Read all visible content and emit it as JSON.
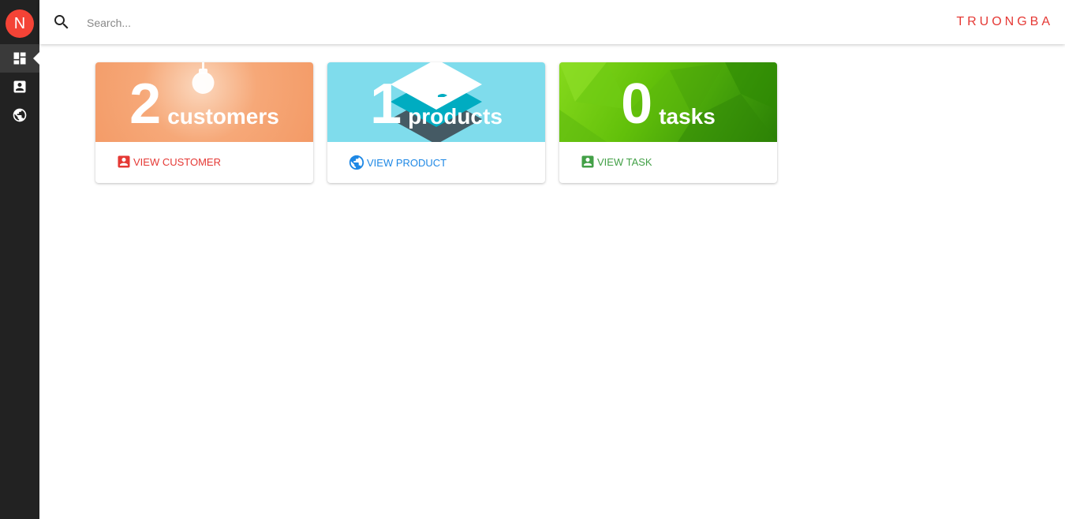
{
  "user": {
    "initial": "N"
  },
  "search": {
    "placeholder": "Search..."
  },
  "brand": {
    "logo_text": "TRUONGBA"
  },
  "sidebar": {
    "items": [
      {
        "icon": "dashboard-icon",
        "active": true
      },
      {
        "icon": "contact-card-icon",
        "active": false
      },
      {
        "icon": "globe-icon",
        "active": false
      }
    ]
  },
  "cards": [
    {
      "count": "2",
      "unit": "customers",
      "action": "VIEW CUSTOMER",
      "action_icon": "contact-card-icon",
      "action_color": "#e53935"
    },
    {
      "count": "1",
      "unit": "products",
      "action": "VIEW PRODUCT",
      "action_icon": "globe-icon",
      "action_color": "#1e88e5"
    },
    {
      "count": "0",
      "unit": "tasks",
      "action": "VIEW TASK",
      "action_icon": "contact-card-icon",
      "action_color": "#43a047"
    }
  ],
  "colors": {
    "sidebar_bg": "#222222",
    "avatar_bg": "#f44336",
    "brand": "#e53935"
  }
}
